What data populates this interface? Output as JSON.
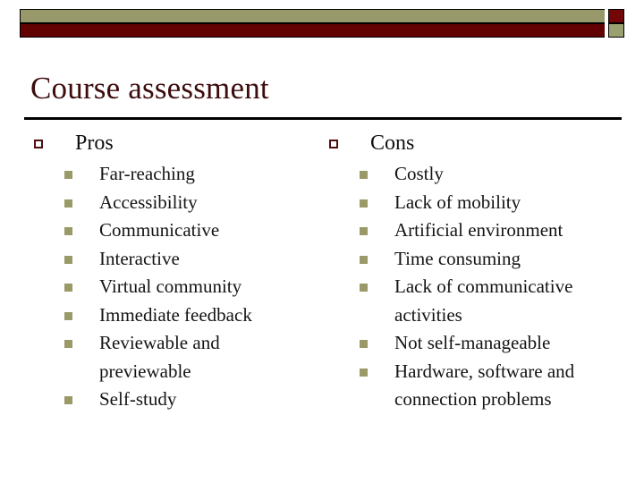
{
  "banner": {
    "olive_color": "#97996b",
    "red_color": "#620101",
    "cap_red_color": "#730606",
    "cap_olive_color": "#9ba070",
    "rule_color": "#000000"
  },
  "slide": {
    "title": "Course assessment",
    "title_color": "#3d0c0c"
  },
  "bullets": {
    "level1_icon": "hollow-square-bullet",
    "level1_color": "#4d1111",
    "level2_icon": "filled-square-bullet",
    "level2_color": "#9a9a68"
  },
  "columns": [
    {
      "heading": "Pros",
      "items": [
        "Far-reaching",
        "Accessibility",
        "Communicative",
        "Interactive",
        "Virtual community",
        "Immediate feedback",
        "Reviewable and previewable",
        "Self-study"
      ]
    },
    {
      "heading": "Cons",
      "items": [
        "Costly",
        "Lack of mobility",
        "Artificial environment",
        "Time consuming",
        "Lack of communicative activities",
        "Not self-manageable",
        "Hardware, software and connection problems"
      ]
    }
  ]
}
